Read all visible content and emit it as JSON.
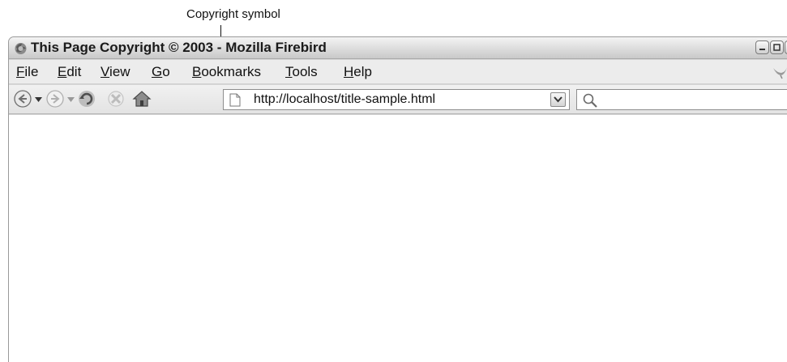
{
  "annotation": {
    "label": "Copyright symbol"
  },
  "window": {
    "title": "This Page Copyright © 2003 - Mozilla Firebird",
    "icon": "firebird-logo-icon",
    "controls": [
      "minimize-icon",
      "maximize-icon",
      "close-icon"
    ]
  },
  "menu": {
    "items": [
      {
        "accel": "F",
        "rest": "ile"
      },
      {
        "accel": "E",
        "rest": "dit"
      },
      {
        "accel": "V",
        "rest": "iew"
      },
      {
        "accel": "G",
        "rest": "o"
      },
      {
        "accel": "B",
        "rest": "ookmarks"
      },
      {
        "accel": "T",
        "rest": "ools"
      },
      {
        "accel": "H",
        "rest": "elp"
      }
    ],
    "throbber_icon": "firebird-throbber-icon"
  },
  "toolbar": {
    "buttons": [
      "back-icon",
      "forward-icon",
      "reload-icon",
      "stop-icon",
      "home-icon"
    ],
    "url": "http://localhost/title-sample.html",
    "search_value": ""
  },
  "colors": {
    "chrome": "#d6d6d6",
    "titlebar": "#dcdcdc",
    "content": "#ffffff"
  }
}
